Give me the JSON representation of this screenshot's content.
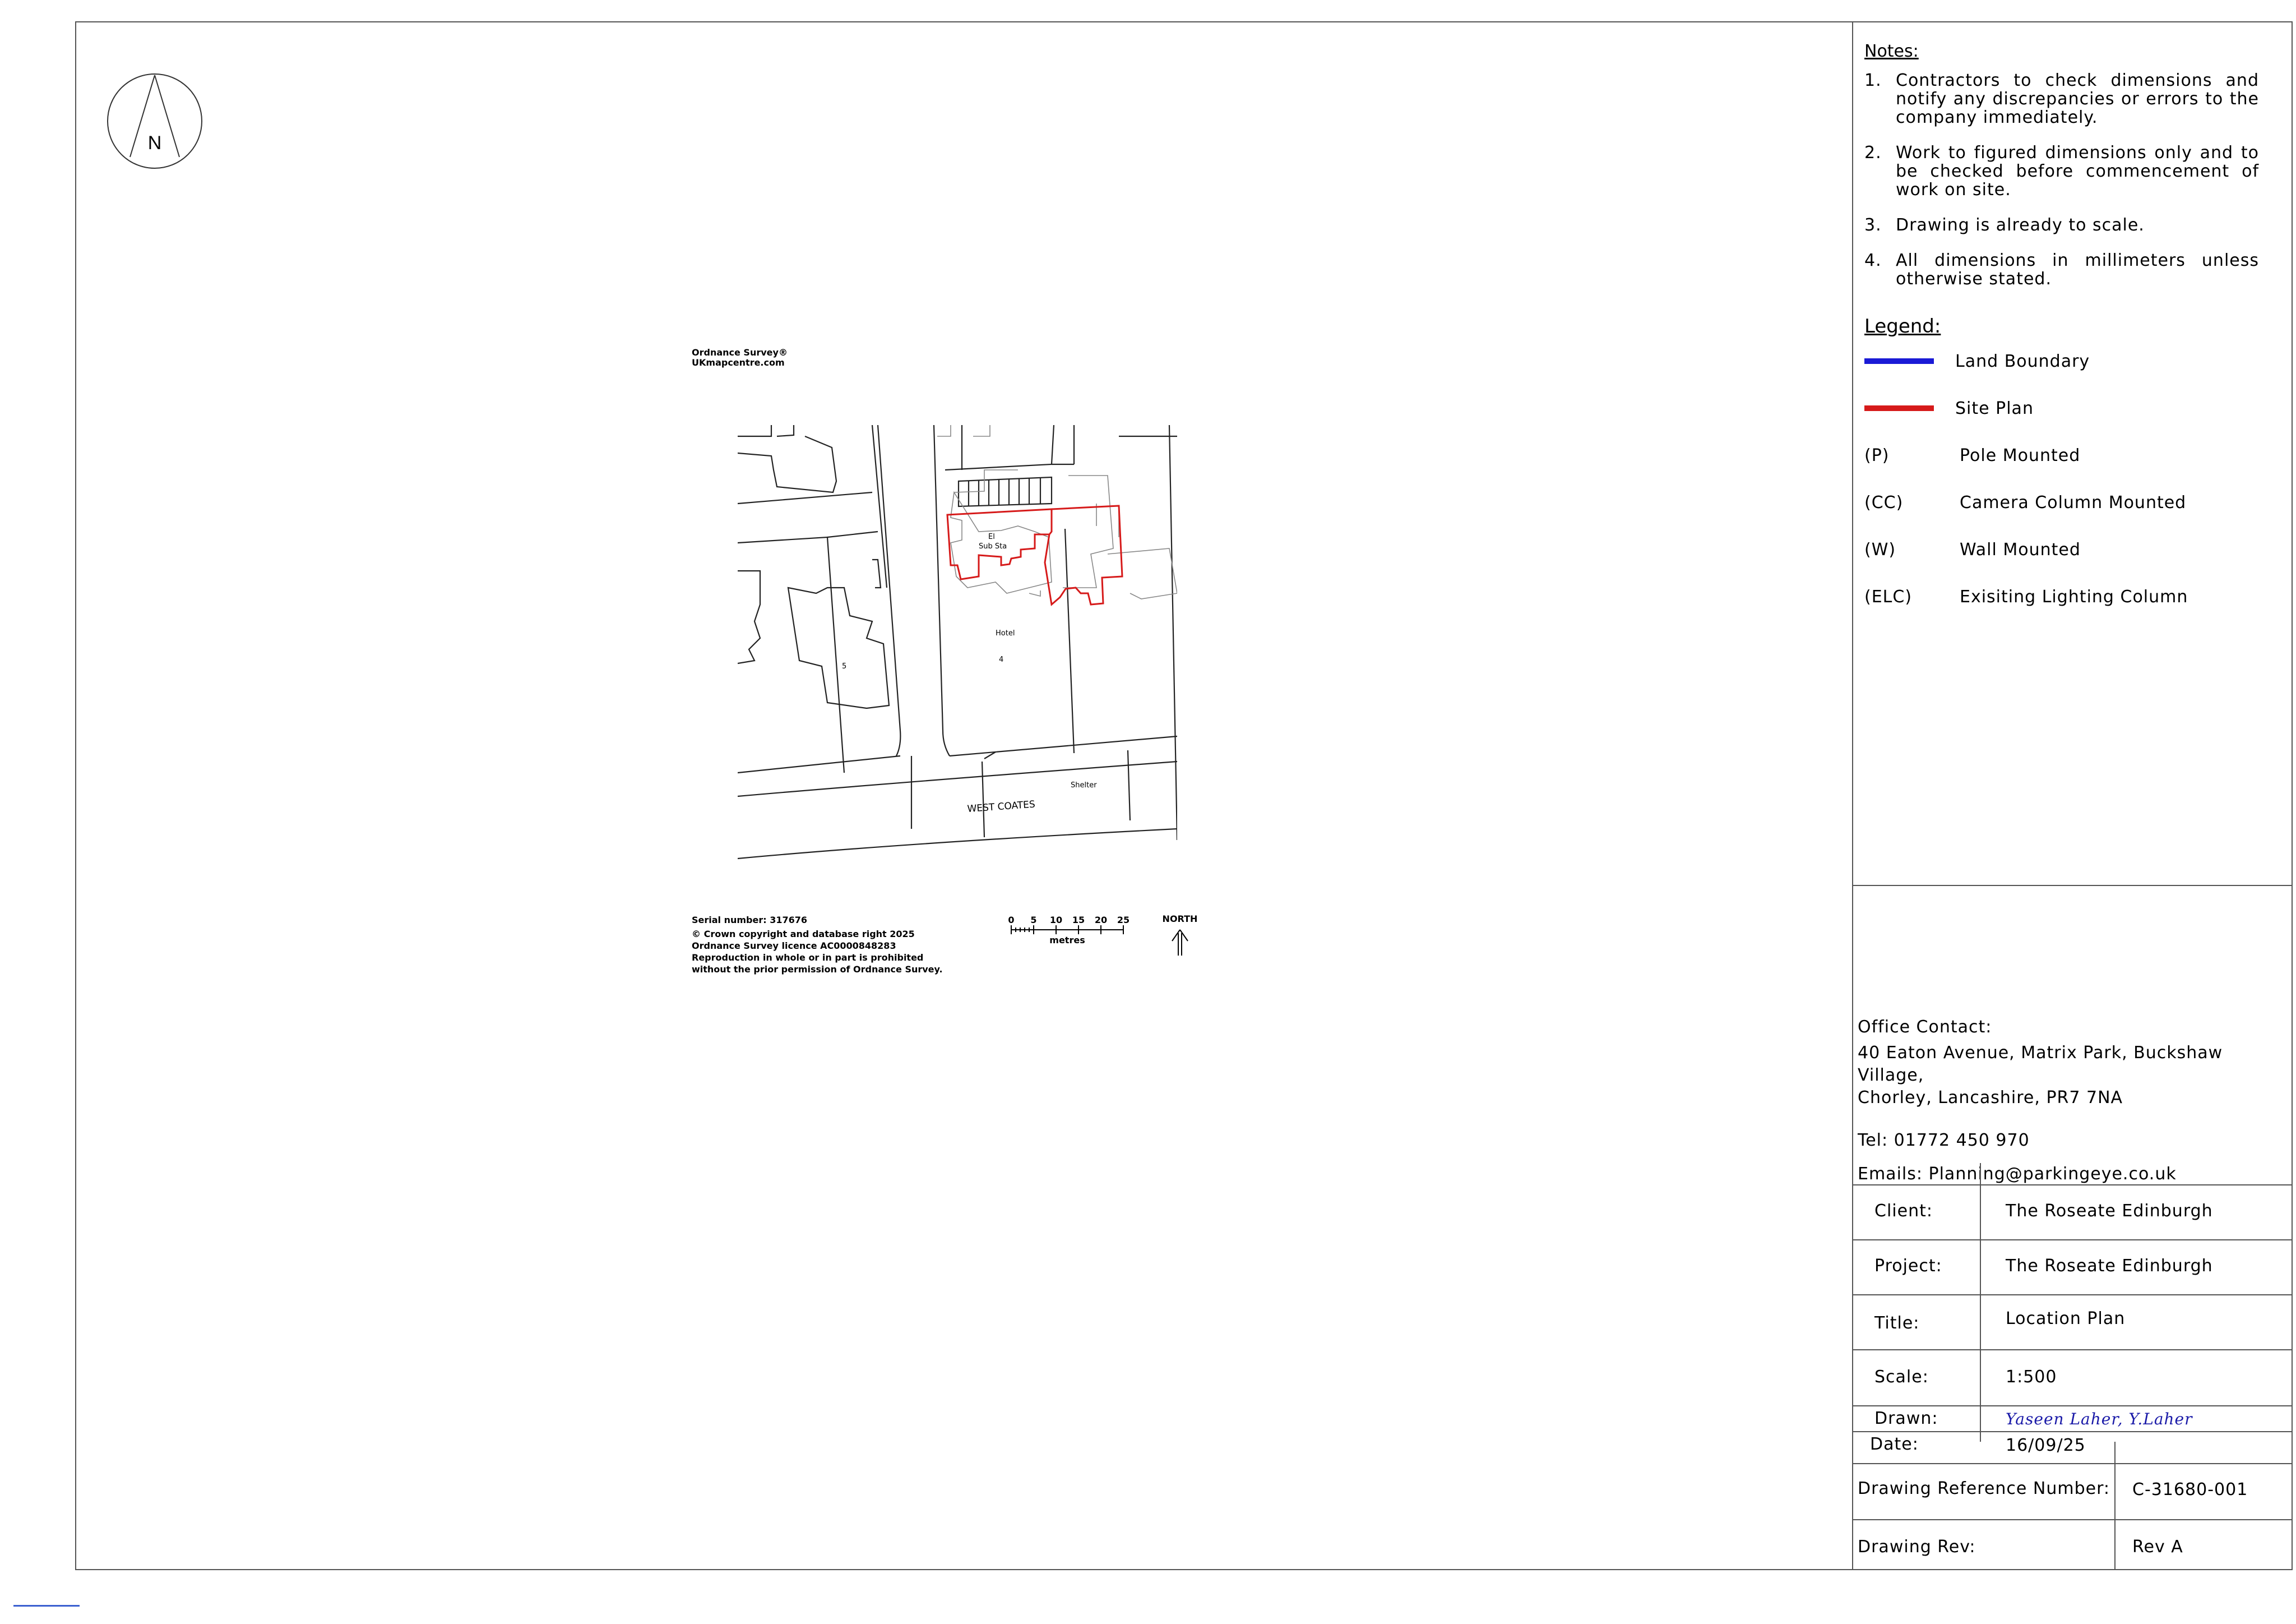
{
  "compass": {
    "label": "N"
  },
  "notes": {
    "title": "Notes:",
    "items": [
      {
        "num": "1.",
        "text": "Contractors to check dimensions and notify any discrepancies or errors to the company immediately."
      },
      {
        "num": "2.",
        "text": "Work to figured dimensions only and to be checked before commencement of work on site."
      },
      {
        "num": "3.",
        "text": "Drawing is already to scale."
      },
      {
        "num": "4.",
        "text": "All dimensions in millimeters unless otherwise stated."
      }
    ]
  },
  "legend": {
    "title": "Legend:",
    "lines": [
      {
        "label": "Land Boundary",
        "color": "#1a1ad6"
      },
      {
        "label": "Site Plan",
        "color": "#d61a1a"
      }
    ],
    "abbreviations": [
      {
        "code": "(P)",
        "label": "Pole Mounted"
      },
      {
        "code": "(CC)",
        "label": "Camera Column Mounted"
      },
      {
        "code": "(W)",
        "label": "Wall Mounted"
      },
      {
        "code": "(ELC)",
        "label": "Exisiting Lighting Column"
      }
    ]
  },
  "contact": {
    "heading": "Office Contact:",
    "address_line1": "40 Eaton Avenue, Matrix Park, Buckshaw Village,",
    "address_line2": "Chorley, Lancashire, PR7 7NA",
    "tel": "Tel: 01772 450 970",
    "email": "Emails: Planning@parkingeye.co.uk"
  },
  "title_block": {
    "client_label": "Client:",
    "client": "The Roseate Edinburgh",
    "project_label": "Project:",
    "project": "The Roseate Edinburgh",
    "title_label": "Title:",
    "title": "Location Plan",
    "scale_label": "Scale:",
    "scale": "1:500",
    "drawn_label": "Drawn:",
    "drawn": "Yaseen Laher, Y.Laher",
    "date_label": "Date:",
    "date": "16/09/25",
    "ref_label": "Drawing Reference Number:",
    "ref": "C-31680-001",
    "rev_label": "Drawing Rev:",
    "rev": "Rev A"
  },
  "os_map": {
    "header_line1": "Ordnance Survey®",
    "header_line2": "UKmapcentre.com",
    "labels": {
      "substation": "El",
      "substation2": "Sub Sta",
      "hotel": "Hotel",
      "house4": "4",
      "house5": "5",
      "shelter": "Shelter",
      "street": "WEST COATES"
    },
    "serial": "Serial number: 317676",
    "copyright1": "© Crown copyright and database right 2025",
    "copyright2": "Ordnance Survey licence AC0000848283",
    "copyright3": "Reproduction in whole or in part is prohibited",
    "copyright4": "without the prior permission of Ordnance Survey.",
    "scale_ticks": [
      "0",
      "5",
      "10",
      "15",
      "20",
      "25"
    ],
    "scale_unit": "metres",
    "north": "NORTH"
  }
}
